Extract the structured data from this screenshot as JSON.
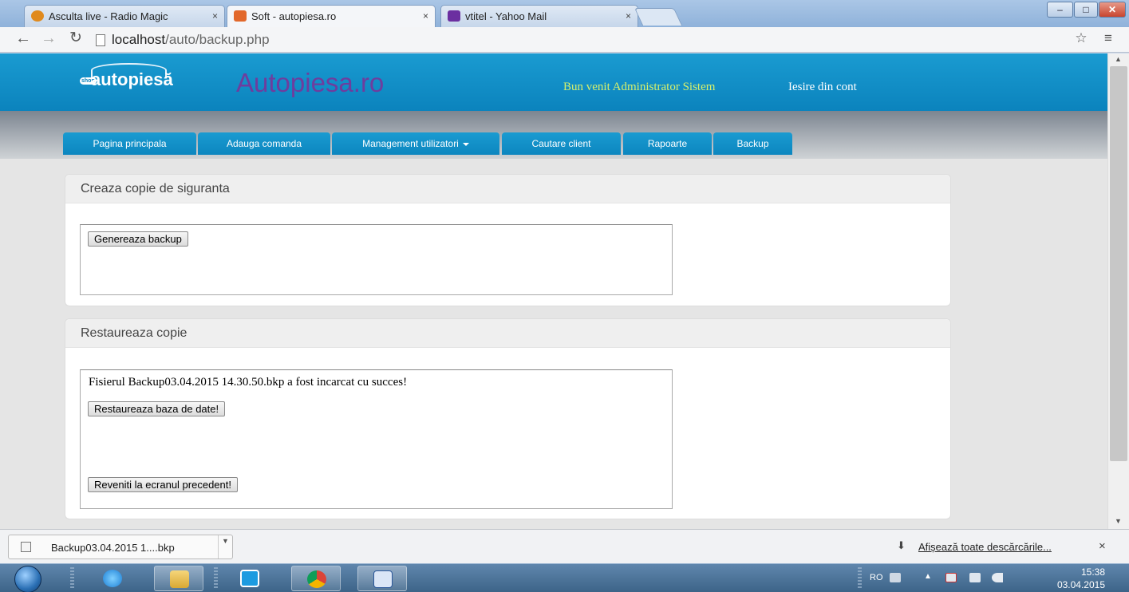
{
  "browser": {
    "tabs": [
      {
        "title": "Asculta live - Radio Magic",
        "close": "×",
        "fav_color": "#e08a1e"
      },
      {
        "title": "Soft - autopiesa.ro",
        "close": "×",
        "fav_color": "#e2682b"
      },
      {
        "title": "vtitel - Yahoo Mail",
        "close": "×",
        "fav_color": "#6b2fa0"
      }
    ],
    "window_controls": {
      "minimize": "–",
      "maximize": "□",
      "close": "✕"
    },
    "url_host": "localhost",
    "url_path": "/auto/backup.php"
  },
  "header": {
    "logo_shop": "shop",
    "logo_word": "autopiesă",
    "site_title": "Autopiesa.ro",
    "welcome": "Bun venit Administrator Sistem",
    "logout": "Iesire din cont"
  },
  "nav": {
    "items": [
      {
        "label": "Pagina principala"
      },
      {
        "label": "Adauga comanda"
      },
      {
        "label": "Management utilizatori"
      },
      {
        "label": "Cautare client"
      },
      {
        "label": "Rapoarte"
      },
      {
        "label": "Backup"
      }
    ]
  },
  "backup_panel": {
    "title": "Creaza copie de siguranta",
    "generate_button": "Genereaza backup"
  },
  "restore_panel": {
    "title": "Restaureaza copie",
    "message": "Fisierul Backup03.04.2015 14.30.50.bkp a fost incarcat cu succes!",
    "restore_button": "Restaureaza baza de date!",
    "back_button": "Reveniti la ecranul precedent!"
  },
  "download_bar": {
    "file_name": "Backup03.04.2015 1....bkp",
    "show_all": "Afișează toate descărcările...",
    "close": "×"
  },
  "taskbar": {
    "language": "RO",
    "time": "15:38",
    "date": "03.04.2015"
  },
  "colors": {
    "header_blue": "#1a9bd1",
    "title_purple": "#6e3d9e",
    "welcome_green": "#d6f06c"
  }
}
